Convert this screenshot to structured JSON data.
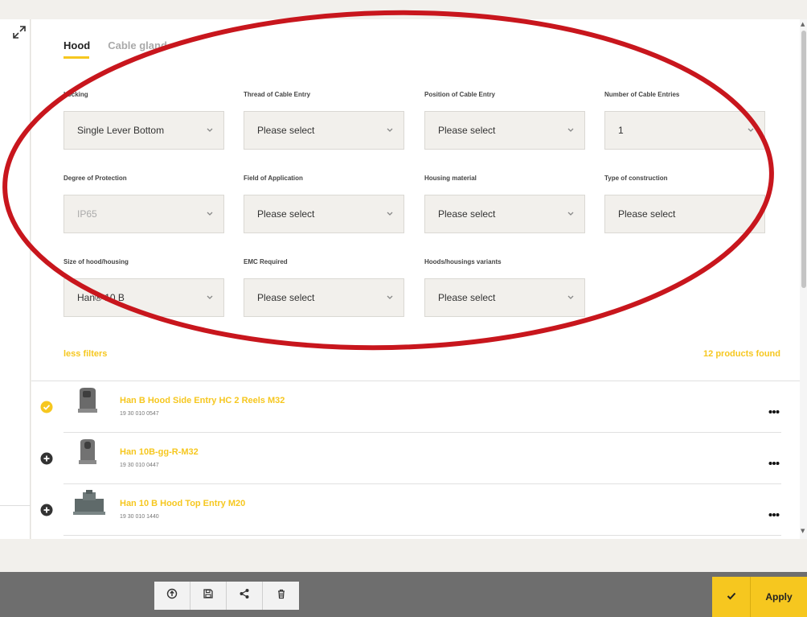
{
  "tabs": [
    {
      "label": "Hood",
      "active": true
    },
    {
      "label": "Cable gland",
      "active": false
    }
  ],
  "filters": [
    {
      "label": "Locking",
      "value": "Single Lever Bottom"
    },
    {
      "label": "Thread of Cable Entry",
      "value": "Please select"
    },
    {
      "label": "Position of Cable Entry",
      "value": "Please select"
    },
    {
      "label": "Number of Cable Entries",
      "value": "1"
    },
    {
      "label": "Degree of Protection",
      "value": "IP65",
      "disabled": true
    },
    {
      "label": "Field of Application",
      "value": "Please select"
    },
    {
      "label": "Housing material",
      "value": "Please select"
    },
    {
      "label": "Type of construction",
      "value": "Please select"
    },
    {
      "label": "Size of hood/housing",
      "value": "Han® 10 B"
    },
    {
      "label": "EMC Required",
      "value": "Please select"
    },
    {
      "label": "Hoods/housings variants",
      "value": "Please select"
    }
  ],
  "less_filters": "less filters",
  "products_found": "12 products found",
  "products": [
    {
      "title": "Han B Hood Side Entry HC 2 Reels M32",
      "code": "19 30 010 0547",
      "selected": true
    },
    {
      "title": "Han 10B-gg-R-M32",
      "code": "19 30 010 0447",
      "selected": false
    },
    {
      "title": "Han 10 B Hood Top Entry M20",
      "code": "19 30 010 1440",
      "selected": false
    }
  ],
  "footer": {
    "apply_label": "Apply"
  },
  "colors": {
    "accent": "#f6c71f",
    "annotation": "#c8161d",
    "footer": "#6e6e6e"
  },
  "icons": {
    "expand": "expand-icon",
    "chevron": "chevron-down-icon",
    "selected": "check-circle-icon",
    "add": "plus-circle-icon",
    "more": "more-horizontal-icon",
    "upload": "upload-icon",
    "save": "save-icon",
    "share": "share-icon",
    "delete": "trash-icon",
    "check": "check-icon"
  }
}
